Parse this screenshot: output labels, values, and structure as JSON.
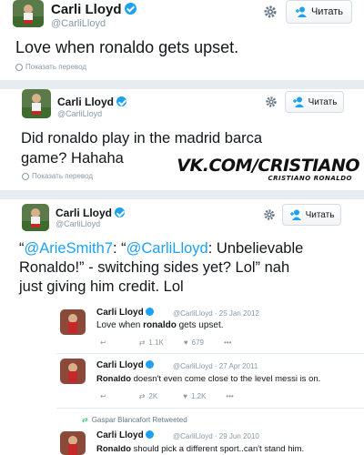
{
  "tweets": [
    {
      "name": "Carli Lloyd",
      "handle": "@CarliLloyd",
      "follow_label": "Читать",
      "text": "Love when ronaldo gets upset.",
      "translate_label": "Показать перевод"
    },
    {
      "name": "Carli Lloyd",
      "handle": "@CarliLloyd",
      "follow_label": "Читать",
      "text_line1": "Did ronaldo play in the madrid barca",
      "text_line2": "game? Hahaha",
      "translate_label": "Показать перевод"
    },
    {
      "name": "Carli Lloyd",
      "handle": "@CarliLloyd",
      "follow_label": "Читать",
      "text_parts": {
        "open_quote": "“",
        "mention1": "@ArieSmith7",
        "colon_quote": ": “",
        "mention2": "@CarliLloyd",
        "line1_rest": ": Unbelievable",
        "line2": "Ronaldo!” - switching sides yet? Lol” nah",
        "line3": "just giving him credit. Lol"
      }
    }
  ],
  "watermark": {
    "main": "VK.COM/CRISTIANO",
    "sub": "CRISTIANO RONALDO"
  },
  "quoted_tweets": [
    {
      "name": "Carli Lloyd",
      "meta": "@CarliLloyd · 25 Jan 2012",
      "text_before": "Love when ",
      "text_bold": "ronaldo",
      "text_after": " gets upset.",
      "retweets": "1.1K",
      "likes": "679"
    },
    {
      "name": "Carli Lloyd",
      "meta": "@CarliLloyd · 27 Apr 2011",
      "text_bold": "Ronaldo",
      "text_after": " doesn't even come close to the level messi is on.",
      "retweets": "2K",
      "likes": "1.2K"
    },
    {
      "retweeted_by": "Gaspar Blancafort Retweeted",
      "name": "Carli Lloyd",
      "meta": "@CarliLloyd · 29 Jun 2010",
      "text_bold": "Ronaldo",
      "text_after": " should pick a different sport..can't stand him."
    }
  ],
  "colors": {
    "accent": "#1da1f2",
    "muted": "#8899a6",
    "divider": "#e6ecf0"
  },
  "icons": [
    "verified-badge-icon",
    "gear-icon",
    "follow-person-icon",
    "globe-icon",
    "reply-icon",
    "retweet-icon",
    "like-icon",
    "more-icon"
  ]
}
